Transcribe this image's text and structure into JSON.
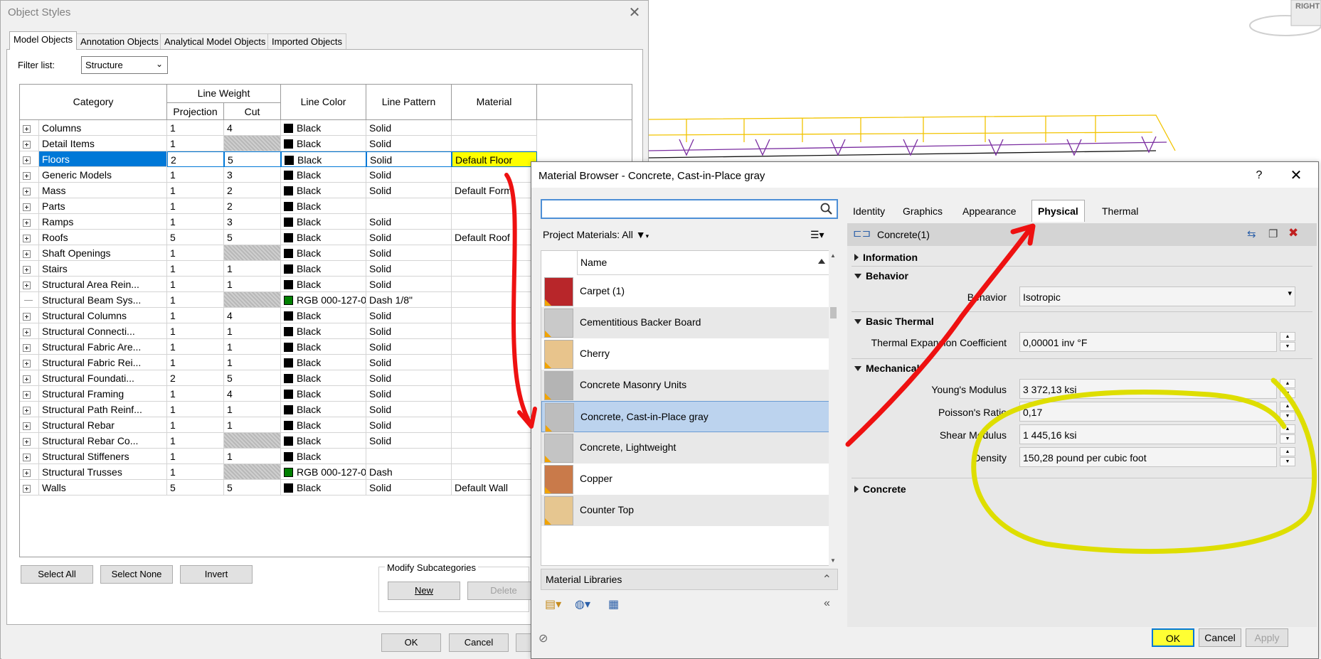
{
  "viewcube": {
    "label": "RIGHT"
  },
  "object_styles": {
    "title": "Object Styles",
    "tabs": [
      "Model Objects",
      "Annotation Objects",
      "Analytical Model Objects",
      "Imported Objects"
    ],
    "filter_label": "Filter list:",
    "filter_value": "Structure",
    "headers": {
      "category": "Category",
      "line_weight": "Line Weight",
      "projection": "Projection",
      "cut": "Cut",
      "line_color": "Line Color",
      "line_pattern": "Line Pattern",
      "material": "Material"
    },
    "rows": [
      {
        "category": "Columns",
        "projection": "1",
        "cut": "4",
        "color": "Black",
        "pattern": "Solid",
        "material": ""
      },
      {
        "category": "Detail Items",
        "projection": "1",
        "cut": "",
        "color": "Black",
        "pattern": "Solid",
        "material": ""
      },
      {
        "category": "Floors",
        "projection": "2",
        "cut": "5",
        "color": "Black",
        "pattern": "Solid",
        "material": "Default Floor"
      },
      {
        "category": "Generic Models",
        "projection": "1",
        "cut": "3",
        "color": "Black",
        "pattern": "Solid",
        "material": ""
      },
      {
        "category": "Mass",
        "projection": "1",
        "cut": "2",
        "color": "Black",
        "pattern": "Solid",
        "material": "Default Form"
      },
      {
        "category": "Parts",
        "projection": "1",
        "cut": "2",
        "color": "Black",
        "pattern": "",
        "material": ""
      },
      {
        "category": "Ramps",
        "projection": "1",
        "cut": "3",
        "color": "Black",
        "pattern": "Solid",
        "material": ""
      },
      {
        "category": "Roofs",
        "projection": "5",
        "cut": "5",
        "color": "Black",
        "pattern": "Solid",
        "material": "Default Roof"
      },
      {
        "category": "Shaft Openings",
        "projection": "1",
        "cut": "",
        "color": "Black",
        "pattern": "Solid",
        "material": ""
      },
      {
        "category": "Stairs",
        "projection": "1",
        "cut": "1",
        "color": "Black",
        "pattern": "Solid",
        "material": ""
      },
      {
        "category": "Structural Area Rein...",
        "projection": "1",
        "cut": "1",
        "color": "Black",
        "pattern": "Solid",
        "material": ""
      },
      {
        "category": "Structural Beam Sys...",
        "projection": "1",
        "cut": "",
        "color": "RGB 000-127-0",
        "pattern": "Dash 1/8\"",
        "material": ""
      },
      {
        "category": "Structural Columns",
        "projection": "1",
        "cut": "4",
        "color": "Black",
        "pattern": "Solid",
        "material": ""
      },
      {
        "category": "Structural Connecti...",
        "projection": "1",
        "cut": "1",
        "color": "Black",
        "pattern": "Solid",
        "material": ""
      },
      {
        "category": "Structural Fabric Are...",
        "projection": "1",
        "cut": "1",
        "color": "Black",
        "pattern": "Solid",
        "material": ""
      },
      {
        "category": "Structural Fabric Rei...",
        "projection": "1",
        "cut": "1",
        "color": "Black",
        "pattern": "Solid",
        "material": ""
      },
      {
        "category": "Structural Foundati...",
        "projection": "2",
        "cut": "5",
        "color": "Black",
        "pattern": "Solid",
        "material": ""
      },
      {
        "category": "Structural Framing",
        "projection": "1",
        "cut": "4",
        "color": "Black",
        "pattern": "Solid",
        "material": ""
      },
      {
        "category": "Structural Path Reinf...",
        "projection": "1",
        "cut": "1",
        "color": "Black",
        "pattern": "Solid",
        "material": ""
      },
      {
        "category": "Structural Rebar",
        "projection": "1",
        "cut": "1",
        "color": "Black",
        "pattern": "Solid",
        "material": ""
      },
      {
        "category": "Structural Rebar Co...",
        "projection": "1",
        "cut": "",
        "color": "Black",
        "pattern": "Solid",
        "material": ""
      },
      {
        "category": "Structural Stiffeners",
        "projection": "1",
        "cut": "1",
        "color": "Black",
        "pattern": "",
        "material": ""
      },
      {
        "category": "Structural Trusses",
        "projection": "1",
        "cut": "",
        "color": "RGB 000-127-0",
        "pattern": "Dash",
        "material": ""
      },
      {
        "category": "Walls",
        "projection": "5",
        "cut": "5",
        "color": "Black",
        "pattern": "Solid",
        "material": "Default Wall"
      }
    ],
    "buttons": {
      "select_all": "Select All",
      "select_none": "Select None",
      "invert": "Invert",
      "modify_subcategories": "Modify Subcategories",
      "new": "New",
      "delete": "Delete",
      "ok": "OK",
      "cancel": "Cancel"
    }
  },
  "material_browser": {
    "title": "Material Browser - Concrete, Cast-in-Place gray",
    "filter_label": "Project Materials: All",
    "name_header": "Name",
    "materials": [
      {
        "name": "Carpet (1)",
        "color": "#b8262a",
        "selected": false
      },
      {
        "name": "Cementitious Backer Board",
        "color": "#c9c9c9",
        "selected": false
      },
      {
        "name": "Cherry",
        "color": "#e8c48c",
        "selected": false
      },
      {
        "name": "Concrete Masonry Units",
        "color": "#b4b4b4",
        "selected": false
      },
      {
        "name": "Concrete, Cast-in-Place gray",
        "color": "#bdbdbd",
        "selected": true
      },
      {
        "name": "Concrete, Lightweight",
        "color": "#c4c4c4",
        "selected": false
      },
      {
        "name": "Copper",
        "color": "#c97a4a",
        "selected": false
      },
      {
        "name": "Counter Top",
        "color": "#e6c690",
        "selected": false
      }
    ],
    "libraries_label": "Material Libraries",
    "tabs": [
      "Identity",
      "Graphics",
      "Appearance",
      "Physical",
      "Thermal"
    ],
    "active_tab": "Physical",
    "asset_name": "Concrete(1)",
    "sections": {
      "information": "Information",
      "behavior": "Behavior",
      "basic_thermal": "Basic Thermal",
      "mechanical": "Mechanical",
      "concrete": "Concrete"
    },
    "properties": {
      "behavior_label": "Behavior",
      "behavior_value": "Isotropic",
      "thermal_label": "Thermal Expansion Coefficient",
      "thermal_value": "0,00001 inv °F",
      "youngs_label": "Young's Modulus",
      "youngs_value": "3 372,13 ksi",
      "poisson_label": "Poisson's Ratio",
      "poisson_value": "0,17",
      "shear_label": "Shear Modulus",
      "shear_value": "1 445,16 ksi",
      "density_label": "Density",
      "density_value": "150,28 pound per cubic foot"
    },
    "buttons": {
      "ok": "OK",
      "cancel": "Cancel",
      "apply": "Apply"
    }
  },
  "colors": {
    "selection_blue": "#0078d7",
    "highlight_yellow": "#ffff00",
    "annotation_red": "#ee1111",
    "annotation_yellow": "#dede00",
    "swatch_black": "#000000",
    "swatch_green": "#007f00"
  }
}
